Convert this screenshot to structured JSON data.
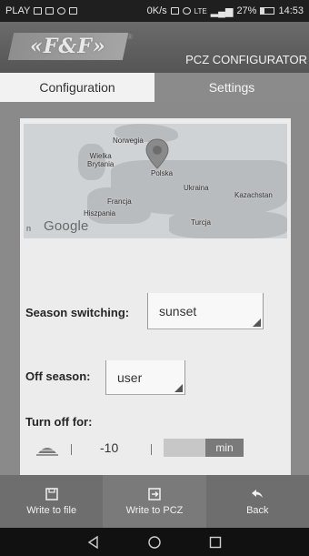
{
  "status_bar": {
    "carrier": "PLAY",
    "speed": "0K/s",
    "network": "LTE",
    "battery": "27%",
    "battery_level": 0.27,
    "time": "14:53"
  },
  "header": {
    "logo_text": "«F&F»",
    "logo_mark": "®",
    "title": "PCZ CONFIGURATOR"
  },
  "tabs": [
    {
      "label": "Configuration",
      "active": true
    },
    {
      "label": "Settings",
      "active": false
    }
  ],
  "map": {
    "labels": {
      "norway": "Norwegia",
      "uk": "Wielka\nBrytania",
      "poland": "Polska",
      "ukraine": "Ukraina",
      "kazakhstan": "Kazachstan",
      "france": "Francja",
      "spain": "Hiszpania",
      "turkey": "Turcja"
    },
    "attribution": "Google",
    "edge_text": "n",
    "pin_icon": "location-pin-icon"
  },
  "season_switching": {
    "label": "Season switching:",
    "value": "sunset"
  },
  "off_season": {
    "label": "Off season:",
    "value": "user"
  },
  "turn_off": {
    "label": "Turn off for:",
    "value": "-10",
    "unit": "min",
    "icon": "dimmed-lamp-icon"
  },
  "bottom_bar": {
    "write_file": "Write to file",
    "write_pcz": "Write to PCZ",
    "back": "Back"
  },
  "colors": {
    "tab_active": "#f2f2f2",
    "tab_inactive": "#8b8b8b",
    "panel": "#ececec",
    "background": "#8a8a8a",
    "bottom_bar": "#6e6e6e"
  }
}
